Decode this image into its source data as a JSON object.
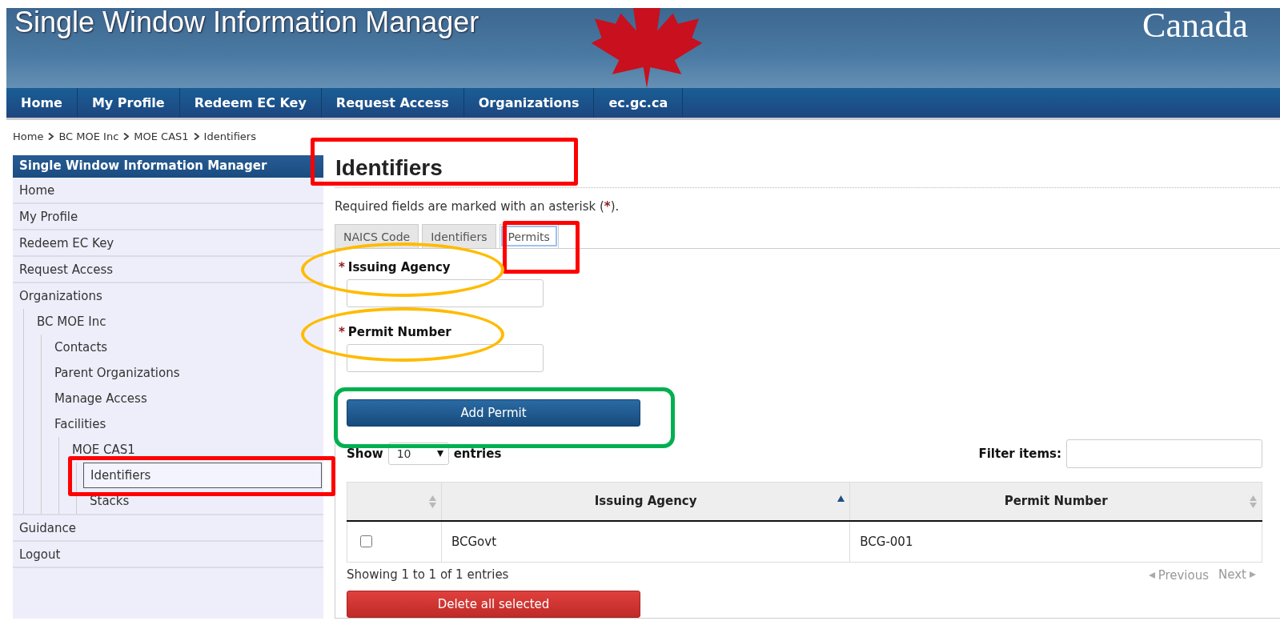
{
  "banner": {
    "title": "Single Window Information Manager",
    "wordmark": "Canada"
  },
  "nav": [
    {
      "label": "Home"
    },
    {
      "label": "My Profile"
    },
    {
      "label": "Redeem EC Key"
    },
    {
      "label": "Request Access"
    },
    {
      "label": "Organizations"
    },
    {
      "label": "ec.gc.ca"
    }
  ],
  "breadcrumb": [
    "Home",
    "BC MOE Inc",
    "MOE CAS1",
    "Identifiers"
  ],
  "sidebar": {
    "title": "Single Window Information Manager",
    "items": [
      {
        "label": "Home",
        "selected": false
      },
      {
        "label": "My Profile",
        "selected": false
      },
      {
        "label": "Redeem EC Key",
        "selected": false
      },
      {
        "label": "Request Access",
        "selected": false
      },
      {
        "label": "Organizations",
        "selected": false,
        "children": [
          {
            "label": "BC MOE Inc",
            "selected": false,
            "children": [
              {
                "label": "Contacts",
                "selected": false
              },
              {
                "label": "Parent Organizations",
                "selected": false
              },
              {
                "label": "Manage Access",
                "selected": false
              },
              {
                "label": "Facilities",
                "selected": false,
                "children": [
                  {
                    "label": "MOE CAS1",
                    "selected": false,
                    "children": [
                      {
                        "label": "Identifiers",
                        "selected": true
                      },
                      {
                        "label": "Stacks",
                        "selected": false
                      }
                    ]
                  }
                ]
              }
            ]
          }
        ]
      },
      {
        "label": "Guidance",
        "selected": false
      },
      {
        "label": "Logout",
        "selected": false
      }
    ]
  },
  "page_title": "Identifiers",
  "required_note": {
    "before": "Required fields are marked with an asterisk (",
    "mark": "*",
    "after": ")."
  },
  "tabs": [
    {
      "label": "NAICS Code",
      "selected": false
    },
    {
      "label": "Identifiers",
      "selected": false
    },
    {
      "label": "Permits",
      "selected": true
    }
  ],
  "fields": [
    {
      "label": "Issuing Agency",
      "required_mark": "*"
    },
    {
      "label": "Permit Number",
      "required_mark": "*"
    }
  ],
  "add_button": "Add Permit",
  "length_menu": {
    "before": "Show",
    "value": "10",
    "after": "entries"
  },
  "filter": {
    "label": "Filter items:"
  },
  "table": {
    "columns": [
      {
        "sorted_ascending": false
      },
      {
        "label": "Issuing Agency",
        "sorted_ascending": true
      },
      {
        "label": "Permit Number",
        "sorted_ascending": false
      }
    ],
    "rows": [
      {
        "checked": false,
        "cells": [
          "",
          "BCGovt",
          "BCG-001"
        ]
      }
    ]
  },
  "info": "Showing 1 to 1 of 1 entries",
  "pagination": [
    {
      "label": "Previous",
      "disabled": true,
      "kind": "prev"
    },
    {
      "label": "Next",
      "disabled": true,
      "kind": "next"
    }
  ],
  "delete_button": "Delete all selected",
  "annotations": [
    {
      "kind": "rectangle",
      "color": "#ff0000"
    },
    {
      "kind": "rectangle",
      "color": "#ff0000"
    },
    {
      "kind": "rectangle",
      "color": "#ff0000"
    },
    {
      "kind": "ellipse",
      "color": "#ffbb00"
    },
    {
      "kind": "ellipse",
      "color": "#ffbb00"
    },
    {
      "kind": "rounded",
      "color": "#00b050"
    }
  ]
}
